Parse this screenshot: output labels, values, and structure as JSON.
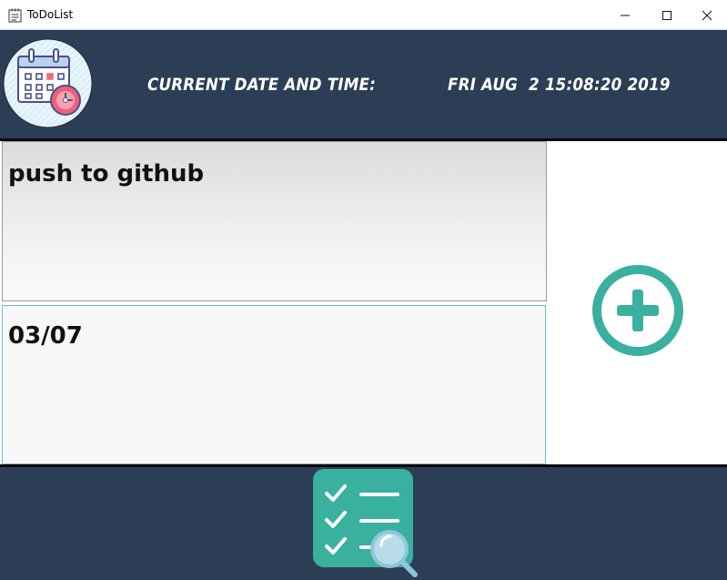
{
  "window": {
    "title": "ToDoList",
    "icon": "notepad-icon",
    "controls": [
      "minimize-icon",
      "maximize-icon",
      "close-icon"
    ]
  },
  "header": {
    "logo_icon": "calendar-clock-icon",
    "datetime_label": "Current date and time:",
    "datetime_value": "Fri Aug  2 15:08:20 2019"
  },
  "form": {
    "task_value": "push to github",
    "date_value": "03/07"
  },
  "actions": {
    "add_icon": "plus-circle-icon",
    "list_icon": "checklist-search-icon"
  },
  "colors": {
    "header_bg": "#2c3e55",
    "accent_teal": "#3ab09e",
    "divider": "#0a0a0a"
  }
}
